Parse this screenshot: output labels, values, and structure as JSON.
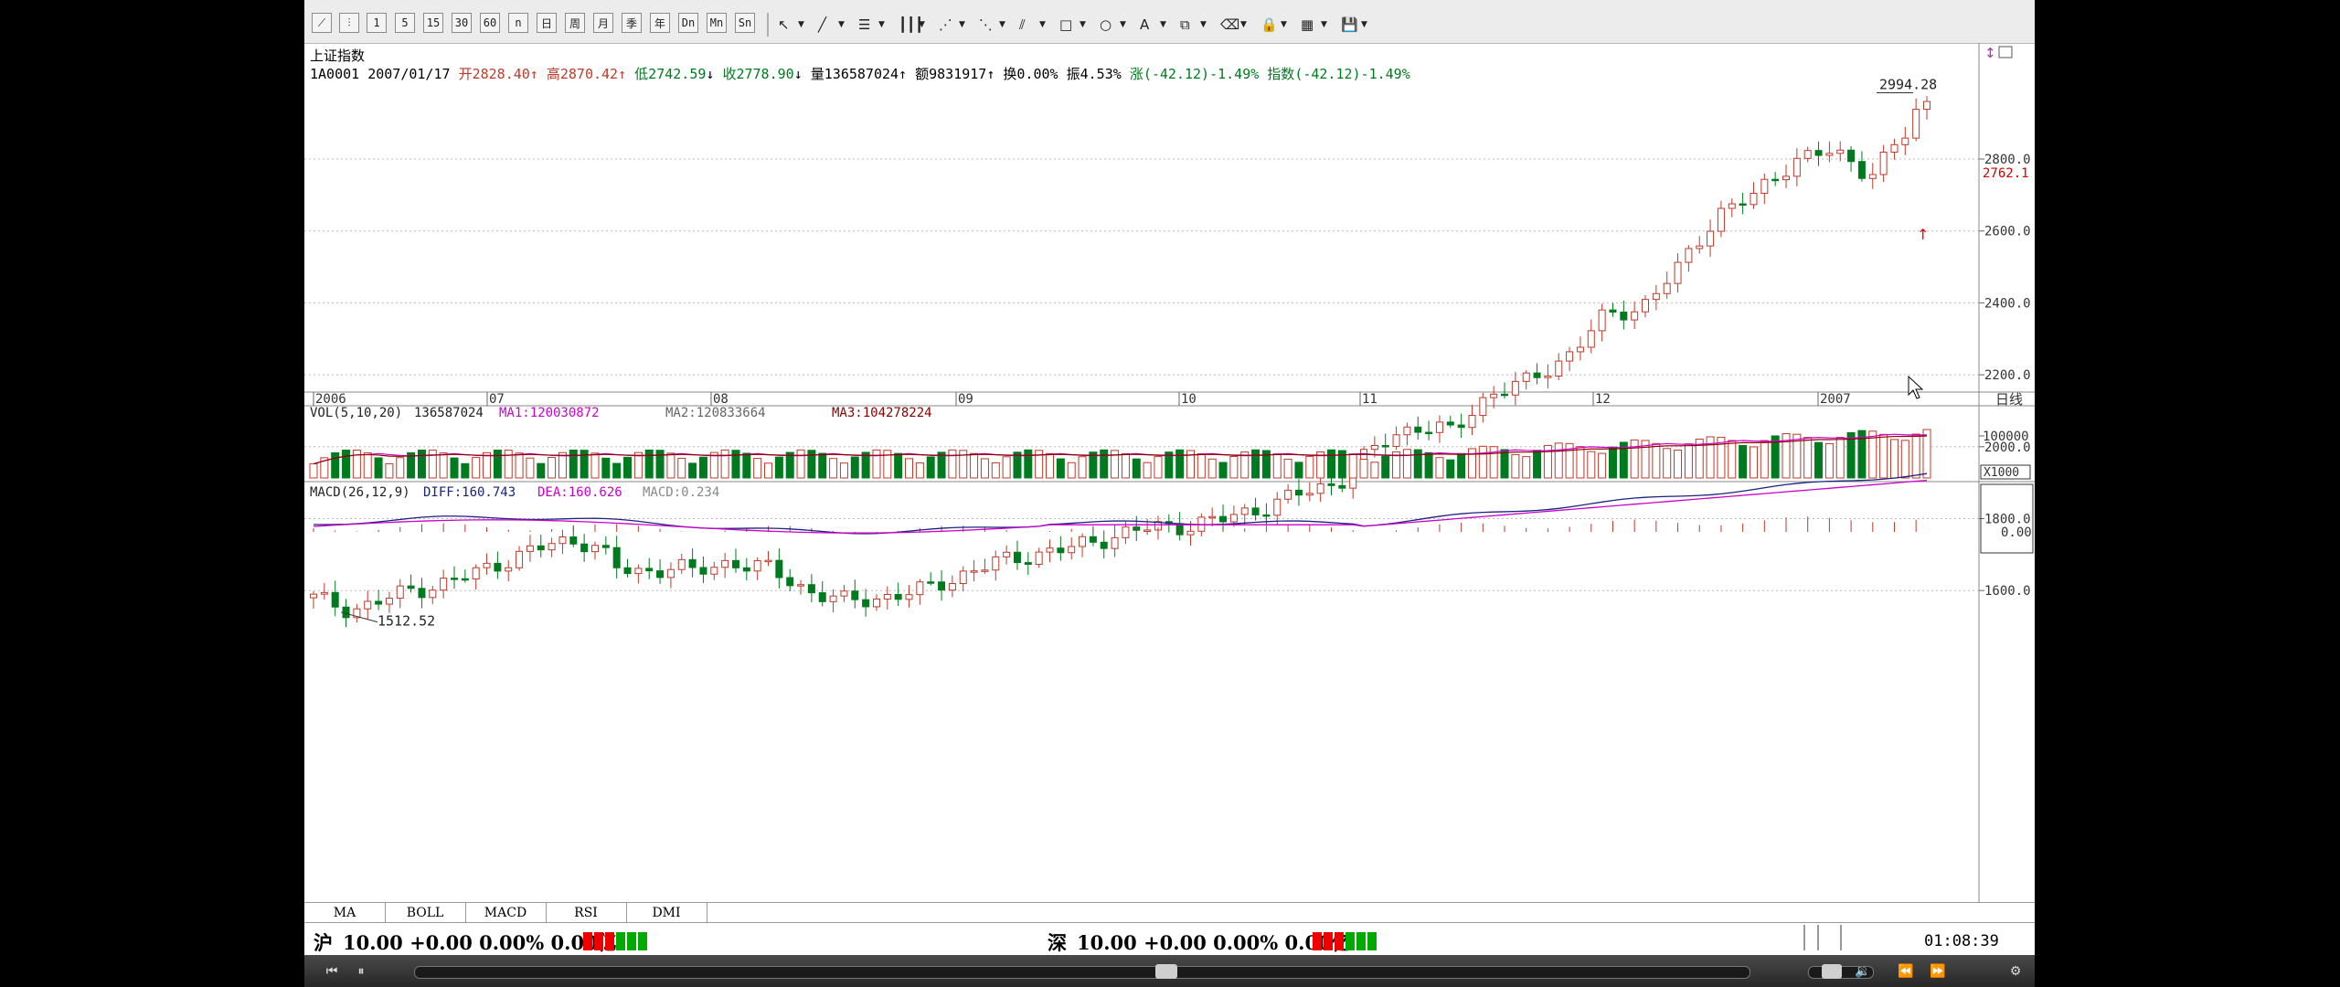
{
  "toolbar": {
    "buttons": [
      {
        "name": "line-chart-icon",
        "glyph": "⟋"
      },
      {
        "name": "kline-chart-icon",
        "glyph": "⫶"
      },
      {
        "name": "period-1min-button",
        "glyph": "1"
      },
      {
        "name": "period-5min-button",
        "glyph": "5"
      },
      {
        "name": "period-15min-button",
        "glyph": "15"
      },
      {
        "name": "period-30min-button",
        "glyph": "30"
      },
      {
        "name": "period-60min-button",
        "glyph": "60"
      },
      {
        "name": "period-multi-button",
        "glyph": "n"
      },
      {
        "name": "period-day-button",
        "glyph": "日"
      },
      {
        "name": "period-week-button",
        "glyph": "周"
      },
      {
        "name": "period-month-button",
        "glyph": "月"
      },
      {
        "name": "period-season-button",
        "glyph": "季"
      },
      {
        "name": "period-year-button",
        "glyph": "年"
      },
      {
        "name": "period-dn-button",
        "glyph": "Dn"
      },
      {
        "name": "period-mn-button",
        "glyph": "Mn"
      },
      {
        "name": "period-sn-button",
        "glyph": "Sn"
      }
    ],
    "tools": [
      {
        "name": "pointer-tool-icon",
        "glyph": "↖"
      },
      {
        "name": "line-tool-icon",
        "glyph": "╱"
      },
      {
        "name": "channel-tool-icon",
        "glyph": "☰"
      },
      {
        "name": "period-lines-tool-icon",
        "glyph": "┃┃┃"
      },
      {
        "name": "fan-tool-icon",
        "glyph": "⋰"
      },
      {
        "name": "gann-tool-icon",
        "glyph": "⋱"
      },
      {
        "name": "parallel-tool-icon",
        "glyph": "⫽"
      },
      {
        "name": "rectangle-tool-icon",
        "glyph": "□"
      },
      {
        "name": "ellipse-tool-icon",
        "glyph": "○"
      },
      {
        "name": "text-tool-icon",
        "glyph": "A"
      },
      {
        "name": "copy-tool-icon",
        "glyph": "⧉"
      },
      {
        "name": "eraser-tool-icon",
        "glyph": "⌫"
      },
      {
        "name": "lock-tool-icon",
        "glyph": "🔒"
      },
      {
        "name": "color-tool-icon",
        "glyph": "▦"
      },
      {
        "name": "save-tool-icon",
        "glyph": "💾"
      }
    ]
  },
  "chart": {
    "index_name": "上证指数",
    "code": "1A0001",
    "date": "2007/01/17",
    "open_label": "开",
    "open": "2828.40",
    "high_label": "高",
    "high": "2870.42",
    "low_label": "低",
    "low": "2742.59",
    "close_label": "收",
    "close": "2778.90",
    "volume_label": "量",
    "volume": "136587024",
    "amount_label": "额",
    "amount": "9831917",
    "turnover_label": "换",
    "turnover": "0.00%",
    "amplitude_label": "振",
    "amplitude": "4.53%",
    "change_label": "涨",
    "change": "(-42.12)-1.49%",
    "index_label": "指数",
    "index_change": "(-42.12)-1.49%",
    "max_label": "2994.28",
    "min_label": "1512.52",
    "current_price_tag": "2762.1",
    "period_label": "日线",
    "x_labels": [
      "2006",
      "07",
      "08",
      "09",
      "10",
      "11",
      "12",
      "2007"
    ],
    "y_ticks": [
      "2800.0",
      "2600.0",
      "2400.0",
      "2200.0",
      "2000.0",
      "1800.0",
      "1600.0"
    ],
    "vol_title": "VOL(5,10,20)",
    "vol_value": "136587024",
    "ma1_text": "MA1:120030872",
    "ma2_text": "MA2:120833664",
    "ma3_text": "MA3:104278224",
    "vol_tick": "100000",
    "vol_unit": "X1000",
    "macd_title": "MACD(26,12,9)",
    "diff_text": "DIFF:160.743",
    "dea_text": "DEA:160.626",
    "macd_text": "MACD:0.234",
    "macd_tick": "0.00",
    "up_color": "#c0392b",
    "down_color": "#007a1e"
  },
  "indicator_tabs": [
    "MA",
    "BOLL",
    "MACD",
    "RSI",
    "DMI"
  ],
  "status": {
    "sh_label": "沪",
    "sh_text": "10.00 +0.00 0.00% 0.00亿",
    "sz_label": "深",
    "sz_text": "10.00 +0.00 0.00% 0.00亿",
    "time": "01:08:39"
  },
  "player": {
    "seek_fraction": 0.563,
    "volume_fraction": 0.35
  }
}
